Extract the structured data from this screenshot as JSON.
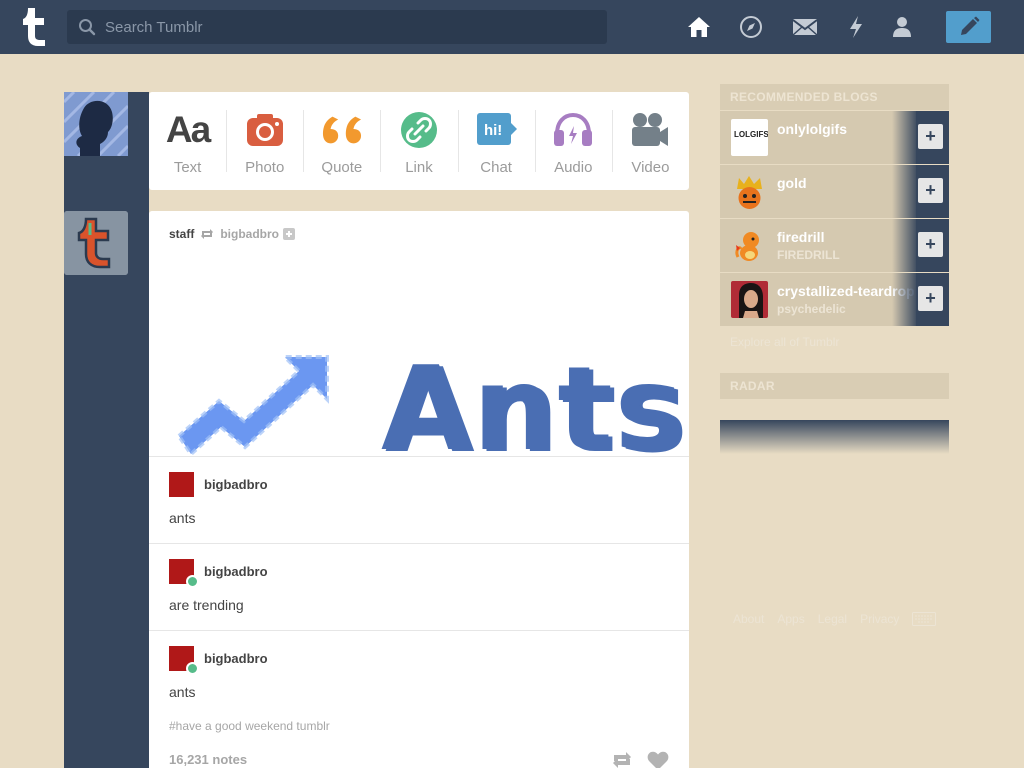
{
  "header": {
    "search_placeholder": "Search Tumblr",
    "nav_icons": [
      "home-icon",
      "compass-icon",
      "mail-icon",
      "lightning-icon",
      "person-icon"
    ],
    "compose_icon": "pencil-icon"
  },
  "post_types": [
    {
      "label": "Text",
      "icon": "text-icon",
      "glyph": "Aa",
      "color": "#444444"
    },
    {
      "label": "Photo",
      "icon": "camera-icon",
      "color": "#d95e40"
    },
    {
      "label": "Quote",
      "icon": "quote-icon",
      "color": "#f2992e"
    },
    {
      "label": "Link",
      "icon": "link-icon",
      "color": "#56bc8a"
    },
    {
      "label": "Chat",
      "icon": "chat-icon",
      "glyph": "hi!",
      "color": "#529ecc"
    },
    {
      "label": "Audio",
      "icon": "headphones-icon",
      "color": "#a77dc2"
    },
    {
      "label": "Video",
      "icon": "video-camera-icon",
      "color": "#748089"
    }
  ],
  "post": {
    "author": "staff",
    "reblogged_from": "bigbadbro",
    "image_text": "Ants",
    "reblogs": [
      {
        "user": "bigbadbro",
        "text": "ants"
      },
      {
        "user": "bigbadbro",
        "text": "are trending"
      },
      {
        "user": "bigbadbro",
        "text": "ants"
      }
    ],
    "tags": "#have a good weekend tumblr",
    "notes": "16,231 notes"
  },
  "sidebar": {
    "recommended_title": "RECOMMENDED BLOGS",
    "blogs": [
      {
        "name": "onlylolgifs",
        "subtitle": "",
        "avatar_text": "LOLGIFS.NET"
      },
      {
        "name": "gold",
        "subtitle": ""
      },
      {
        "name": "firedrill",
        "subtitle": "FIREDRILL"
      },
      {
        "name": "crystallized-teardrops",
        "subtitle": "psychedelic"
      }
    ],
    "explore": "Explore all of Tumblr",
    "radar_title": "RADAR",
    "footer": [
      "About",
      "Apps",
      "Legal",
      "Privacy"
    ]
  },
  "colors": {
    "navy": "#36465d",
    "background": "#e8dcc4",
    "compose": "#529ecc"
  }
}
